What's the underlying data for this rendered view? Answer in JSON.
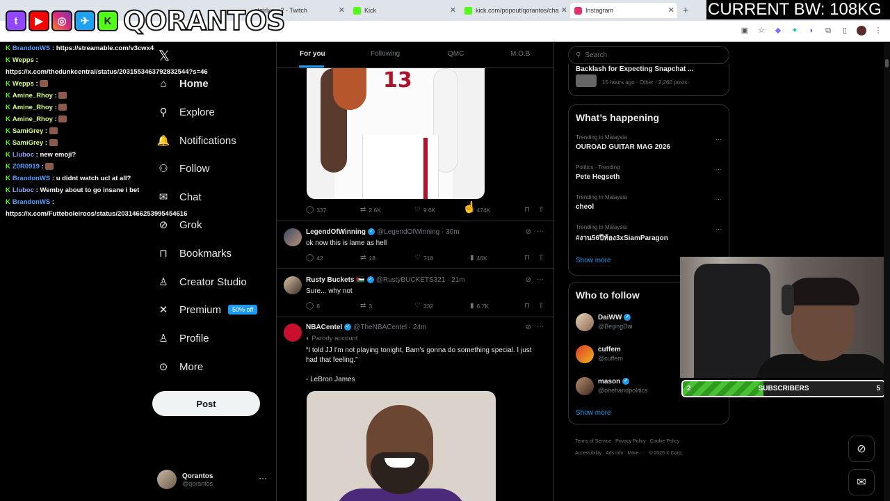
{
  "browser": {
    "tabs": [
      {
        "label": "stgirlxoxx2 - Twitch",
        "color": "#9146ff"
      },
      {
        "label": "Kick",
        "color": "#53fc18"
      },
      {
        "label": "kick.com/popout/qorantos/cha",
        "color": "#53fc18"
      },
      {
        "label": "Instagram",
        "color": "#e1306c"
      }
    ],
    "new_tab": "+"
  },
  "overlay": {
    "brand": "QORANTOS",
    "platform_icons": [
      "twitch-icon",
      "youtube-icon",
      "instagram-icon",
      "twitter-icon",
      "kick-icon"
    ],
    "bw": "CURRENT BW: 108KG"
  },
  "chat": [
    {
      "user": "BrandonWS",
      "cls": "u1",
      "text": "https://streamable.com/v3cwx4"
    },
    {
      "user": "Wepps",
      "cls": "u3",
      "text": ""
    },
    {
      "user": "",
      "cls": "u4",
      "text": "https://x.com/thedunkcentral/status/2031553463792832544?s=46"
    },
    {
      "user": "Wepps",
      "cls": "u3",
      "text": "",
      "emote": true
    },
    {
      "user": "Amine_Rhoy",
      "cls": "u3",
      "text": "",
      "emote": true
    },
    {
      "user": "Amine_Rhoy",
      "cls": "u3",
      "text": "",
      "emote": true
    },
    {
      "user": "Amine_Rhoy",
      "cls": "u3",
      "text": "",
      "emote": true
    },
    {
      "user": "SamiGrey",
      "cls": "u3",
      "text": "",
      "emote": true
    },
    {
      "user": "SamiGrey",
      "cls": "u3",
      "text": "",
      "emote": true
    },
    {
      "user": "Lluboc",
      "cls": "u5",
      "text": "new emoji?"
    },
    {
      "user": "Z0R0919",
      "cls": "u1",
      "text": "",
      "emote": true
    },
    {
      "user": "BrandonWS",
      "cls": "u1",
      "text": "u didnt watch ucl at all?"
    },
    {
      "user": "Lluboc",
      "cls": "u5",
      "text": "Wemby about to go insane i bet"
    },
    {
      "user": "BrandonWS",
      "cls": "u1",
      "text": ""
    },
    {
      "user": "",
      "cls": "u4",
      "text": "https://x.com/Futteboleiroos/status/2031466253995454616"
    }
  ],
  "nav": {
    "items": [
      {
        "label": "Home",
        "icon": "home-icon",
        "glyph": "⌂"
      },
      {
        "label": "Explore",
        "icon": "search-icon",
        "glyph": "⚲"
      },
      {
        "label": "Notifications",
        "icon": "bell-icon",
        "glyph": "🔔"
      },
      {
        "label": "Follow",
        "icon": "add-person-icon",
        "glyph": "⚇"
      },
      {
        "label": "Chat",
        "icon": "mail-icon",
        "glyph": "✉"
      },
      {
        "label": "Grok",
        "icon": "grok-icon",
        "glyph": "⊘"
      },
      {
        "label": "Bookmarks",
        "icon": "bookmark-icon",
        "glyph": "⊓"
      },
      {
        "label": "Creator Studio",
        "icon": "creator-icon",
        "glyph": "♙"
      },
      {
        "label": "Premium",
        "icon": "x-icon",
        "glyph": "✕"
      },
      {
        "label": "Profile",
        "icon": "person-icon",
        "glyph": "♙"
      },
      {
        "label": "More",
        "icon": "more-circle-icon",
        "glyph": "⊙"
      }
    ],
    "premium_badge": "50% off",
    "post": "Post",
    "profile": {
      "name": "Qorantos",
      "handle": "@qorantos",
      "more": "···"
    }
  },
  "feed": {
    "tabs": [
      "For you",
      "Following",
      "QMC",
      "M.O.B"
    ],
    "first_actions": {
      "reply": "337",
      "retweet": "2.6K",
      "like": "9.6K",
      "views": "474K"
    },
    "tweets": [
      {
        "name": "LegendOfWinning",
        "handle": "@LegendOfWinning · 30m",
        "text": "ok now this is lame as hell",
        "reply": "42",
        "retweet": "18",
        "like": "718",
        "views": "46K"
      },
      {
        "name": "Rusty Buckets 🇵🇸",
        "handle": "@RustyBUCKETS321 · 21m",
        "text": "Sure... why not",
        "reply": "8",
        "retweet": "3",
        "like": "332",
        "views": "6.7K"
      },
      {
        "name": "NBACentel",
        "handle": "@TheNBACentel · 24m",
        "parody": "Parody account",
        "text": "“I told JJ I'm not playing tonight, Bam's gonna do something special. I just had that feeling.”",
        "text2": "- LeBron James"
      }
    ]
  },
  "right": {
    "search_placeholder": "Search",
    "top_trend": {
      "name": "Backlash for Expecting Snapchat ...",
      "meta": "15 hours ago · Other · 2,260 posts"
    },
    "happening_title": "What’s happening",
    "trends": [
      {
        "meta": "Trending in Malaysia",
        "name": "OUROAD GUITAR MAG 2026"
      },
      {
        "meta": "Politics · Trending",
        "name": "Pete Hegseth"
      },
      {
        "meta": "Trending in Malaysia",
        "name": "cheol"
      },
      {
        "meta": "Trending in Malaysia",
        "name": "#งาน56ปีห้อง3xSiamParagon"
      }
    ],
    "show_more": "Show more",
    "wtf_title": "Who to follow",
    "wtf": [
      {
        "name": "DaiWW",
        "handle": "@BeijingDai",
        "verified": true
      },
      {
        "name": "cuffem",
        "handle": "@cuffem",
        "verified": false
      },
      {
        "name": "mason",
        "handle": "@onehandpolitics",
        "verified": true
      }
    ],
    "footer": [
      "Terms of Service",
      "Privacy Policy",
      "Cookie Policy",
      "Accessibility",
      "Ads info",
      "More ···",
      "© 2026 X Corp."
    ]
  },
  "subgoal": {
    "current": "2",
    "label": "SUBSCRIBERS",
    "goal": "5",
    "progress": 0.4
  }
}
